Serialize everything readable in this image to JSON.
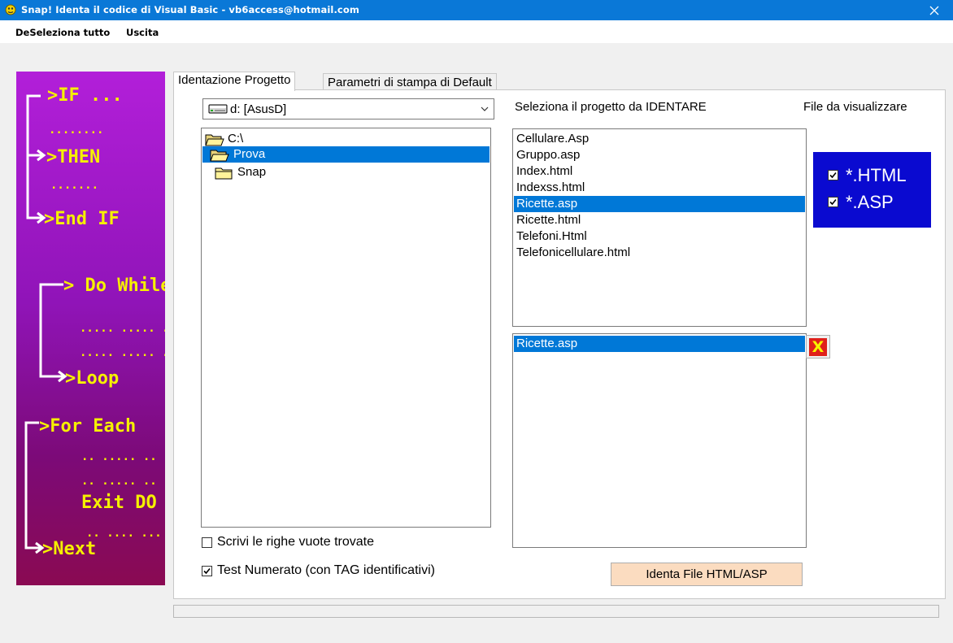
{
  "window": {
    "title": "Snap!  Identa il codice di Visual Basic  - vb6access@hotmail.com"
  },
  "menu": {
    "items": [
      "DeSeleziona tutto",
      "Uscita"
    ]
  },
  "banner": {
    "lines": [
      ">IF ...",
      "........",
      ">THEN",
      ".......",
      ">End IF",
      "> Do While",
      "..... ..... ..",
      "..... ..... ..",
      ">Loop",
      ">For Each",
      ".. ..... ..",
      ".. ..... ..",
      "Exit DO",
      ".. .... ...",
      ">Next"
    ]
  },
  "tabs": [
    {
      "label": "Identazione Progetto",
      "active": true
    },
    {
      "label": "Parametri di stampa di Default",
      "active": false
    }
  ],
  "drive": {
    "value": "d: [AsusD]"
  },
  "folder_tree": {
    "items": [
      {
        "label": "C:\\",
        "selected": false
      },
      {
        "label": "Prova",
        "selected": true
      },
      {
        "label": "Snap",
        "selected": false
      }
    ]
  },
  "labels": {
    "select_project": "Seleziona il progetto da IDENTARE",
    "files_to_show": "File da visualizzare"
  },
  "file_list": {
    "items": [
      {
        "label": "Cellulare.Asp",
        "selected": false
      },
      {
        "label": "Gruppo.asp",
        "selected": false
      },
      {
        "label": "Index.html",
        "selected": false
      },
      {
        "label": "Indexss.html",
        "selected": false
      },
      {
        "label": "Ricette.asp",
        "selected": true
      },
      {
        "label": "Ricette.html",
        "selected": false
      },
      {
        "label": "Telefoni.Html",
        "selected": false
      },
      {
        "label": "Telefonicellulare.html",
        "selected": false
      }
    ]
  },
  "selected_list": {
    "items": [
      {
        "label": "Ricette.asp",
        "selected": true
      }
    ]
  },
  "remove_button": {
    "label": "X"
  },
  "filters": [
    {
      "label": "*.HTML",
      "checked": true
    },
    {
      "label": "*.ASP",
      "checked": true
    }
  ],
  "options": [
    {
      "label": "Scrivi le righe vuote trovate",
      "checked": false
    },
    {
      "label": "Test Numerato (con TAG identificativi)",
      "checked": true
    }
  ],
  "action_button": {
    "label": "Identa File HTML/ASP"
  },
  "colors": {
    "titlebar": "#0a78d7",
    "selection": "#0078d7",
    "filter_panel": "#0a0ad0",
    "banner_text": "#f5f000",
    "action_button": "#fbdcc0",
    "remove_button": "#e0201a"
  },
  "icons": {
    "app": "snap-logo-icon",
    "drive": "hard-drive-icon",
    "folder": "folder-icon",
    "combo": "chevron-down-icon",
    "close": "close-icon"
  }
}
